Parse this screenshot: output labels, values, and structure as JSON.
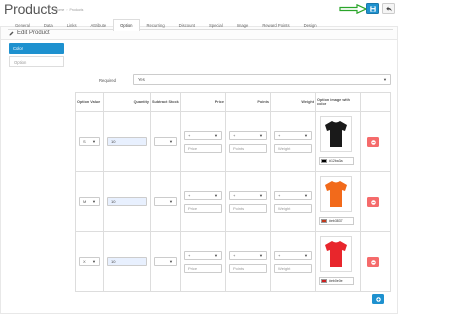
{
  "header": {
    "title": "Products",
    "breadcrumb": [
      "Home",
      "Products"
    ],
    "breadcrumb_sep": "›"
  },
  "panel": {
    "title": "Edit Product"
  },
  "tabs": [
    "General",
    "Data",
    "Links",
    "Attribute",
    "Option",
    "Recurring",
    "Discount",
    "Special",
    "Image",
    "Reward Points",
    "Design"
  ],
  "active_tab": "Option",
  "sidebar": {
    "items": [
      {
        "label": "Color",
        "active": true
      },
      {
        "label": "Option",
        "active": false
      }
    ]
  },
  "required": {
    "label": "Required",
    "value": "Yes"
  },
  "columns": [
    "Option Value",
    "Quantity",
    "Subtract Stock",
    "Price",
    "Points",
    "Weight",
    "Option image with color"
  ],
  "rows": [
    {
      "option_value": "S",
      "quantity": "10",
      "price_prefix": "+",
      "price_placeholder": "Price",
      "points_prefix": "+",
      "points_placeholder": "Points",
      "weight_prefix": "+",
      "weight_placeholder": "Weight",
      "shirt_color": "#1a1a1a",
      "swatch": "#000000",
      "color_code": "#12ba3a"
    },
    {
      "option_value": "M",
      "quantity": "10",
      "price_prefix": "+",
      "price_placeholder": "Price",
      "points_prefix": "+",
      "points_placeholder": "Points",
      "weight_prefix": "+",
      "weight_placeholder": "Weight",
      "shirt_color": "#f26a1b",
      "swatch": "#c0391b",
      "color_code": "#eb3837"
    },
    {
      "option_value": "X",
      "quantity": "10",
      "price_prefix": "+",
      "price_placeholder": "Price",
      "points_prefix": "+",
      "points_placeholder": "Points",
      "weight_prefix": "+",
      "weight_placeholder": "Weight",
      "shirt_color": "#e8262c",
      "swatch": "#cc1f1f",
      "color_code": "#eb0e0e"
    }
  ],
  "colors": {
    "primary": "#1e91cf",
    "danger": "#f56b6b",
    "annotation_arrow": "#2aa52a"
  },
  "icons": {
    "save": "save-icon",
    "back": "reply-icon",
    "remove": "minus-circle-icon",
    "add": "plus-circle-icon",
    "edit": "pencil-icon"
  }
}
